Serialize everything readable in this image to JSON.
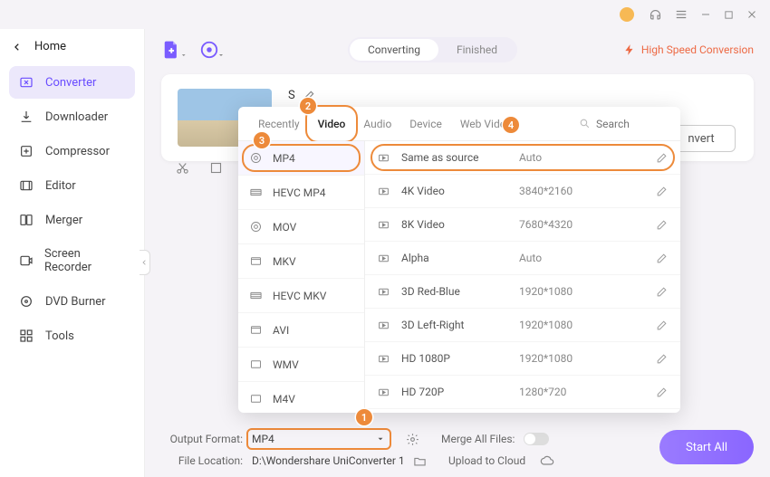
{
  "titlebar": {
    "min": "—",
    "max": "▢",
    "close": "✕"
  },
  "nav": {
    "back": "Home",
    "items": [
      {
        "label": "Converter",
        "icon": "convert"
      },
      {
        "label": "Downloader",
        "icon": "download"
      },
      {
        "label": "Compressor",
        "icon": "compress"
      },
      {
        "label": "Editor",
        "icon": "edit"
      },
      {
        "label": "Merger",
        "icon": "merge"
      },
      {
        "label": "Screen Recorder",
        "icon": "record"
      },
      {
        "label": "DVD Burner",
        "icon": "dvd"
      },
      {
        "label": "Tools",
        "icon": "tools"
      }
    ]
  },
  "topbar": {
    "seg": {
      "a": "Converting",
      "b": "Finished"
    },
    "hsc": "High Speed Conversion"
  },
  "card": {
    "title_prefix": "S",
    "convert": "nvert"
  },
  "popup": {
    "tabs": [
      "Recently",
      "Video",
      "Audio",
      "Device",
      "Web Video"
    ],
    "search_placeholder": "Search",
    "formats": [
      "MP4",
      "HEVC MP4",
      "MOV",
      "MKV",
      "HEVC MKV",
      "AVI",
      "WMV",
      "M4V"
    ],
    "resolutions": [
      {
        "name": "Same as source",
        "value": "Auto"
      },
      {
        "name": "4K Video",
        "value": "3840*2160"
      },
      {
        "name": "8K Video",
        "value": "7680*4320"
      },
      {
        "name": "Alpha",
        "value": "Auto"
      },
      {
        "name": "3D Red-Blue",
        "value": "1920*1080"
      },
      {
        "name": "3D Left-Right",
        "value": "1920*1080"
      },
      {
        "name": "HD 1080P",
        "value": "1920*1080"
      },
      {
        "name": "HD 720P",
        "value": "1280*720"
      }
    ]
  },
  "badges": {
    "b1": "1",
    "b2": "2",
    "b3": "3",
    "b4": "4"
  },
  "bottom": {
    "of_label": "Output Format:",
    "of_value": "MP4",
    "fl_label": "File Location:",
    "fl_value": "D:\\Wondershare UniConverter 1",
    "merge_label": "Merge All Files:",
    "upload_label": "Upload to Cloud",
    "startall": "Start All"
  }
}
